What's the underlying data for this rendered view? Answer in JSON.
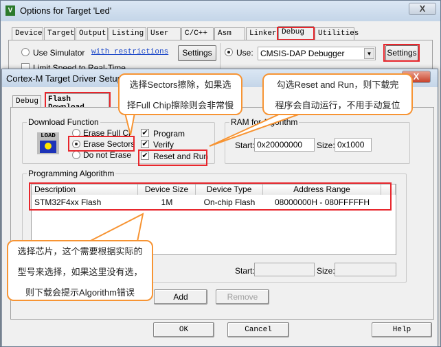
{
  "outer": {
    "title": "Options for Target 'Led'",
    "close": "X",
    "tabs": [
      "Device",
      "Target",
      "Output",
      "Listing",
      "User",
      "C/C++",
      "Asm",
      "Linker",
      "Debug",
      "Utilities"
    ],
    "use_simulator": "Use Simulator",
    "restrictions_link": "with restrictions",
    "settings": "Settings",
    "limit_speed": "Limit Speed to Real-Time",
    "use": "Use:",
    "debugger": "CMSIS-DAP Debugger",
    "settings2": "Settings"
  },
  "inner": {
    "title": "Cortex-M Target Driver Setup",
    "close": "X",
    "tabs": [
      "Debug",
      "Flash Download"
    ],
    "download_function": {
      "label": "Download Function",
      "icon_text": "LOAD",
      "erase_options": [
        "Erase Full Chip",
        "Erase Sectors",
        "Do not Erase"
      ],
      "selected": "Erase Sectors",
      "checks": [
        {
          "label": "Program",
          "checked": true
        },
        {
          "label": "Verify",
          "checked": true
        },
        {
          "label": "Reset and Run",
          "checked": true
        }
      ]
    },
    "ram": {
      "label": "RAM for Algorithm",
      "start_label": "Start:",
      "start": "0x20000000",
      "size_label": "Size:",
      "size": "0x1000"
    },
    "algorithm": {
      "label": "Programming Algorithm",
      "columns": [
        "Description",
        "Device Size",
        "Device Type",
        "Address Range"
      ],
      "rows": [
        [
          "STM32F4xx Flash",
          "1M",
          "On-chip Flash",
          "08000000H - 080FFFFFH"
        ]
      ],
      "start_label": "Start:",
      "start": "",
      "size_label": "Size:",
      "size": ""
    },
    "add": "Add",
    "remove": "Remove",
    "ok": "OK",
    "cancel": "Cancel",
    "help": "Help"
  },
  "callouts": [
    {
      "lines": [
        "选择Sectors擦除，如果选",
        "择Full Chip擦除则会非常慢"
      ]
    },
    {
      "lines": [
        "勾选Reset and Run，则下载完",
        "程序会自动运行，不用手动复位"
      ]
    },
    {
      "lines": [
        "选择芯片，这个需要根据实际的",
        "型号来选择，如果这里没有选，",
        "则下载会提示Algorithm错误"
      ]
    }
  ],
  "colors": {
    "highlight": "#e8262c",
    "callout_border": "#f79433"
  }
}
